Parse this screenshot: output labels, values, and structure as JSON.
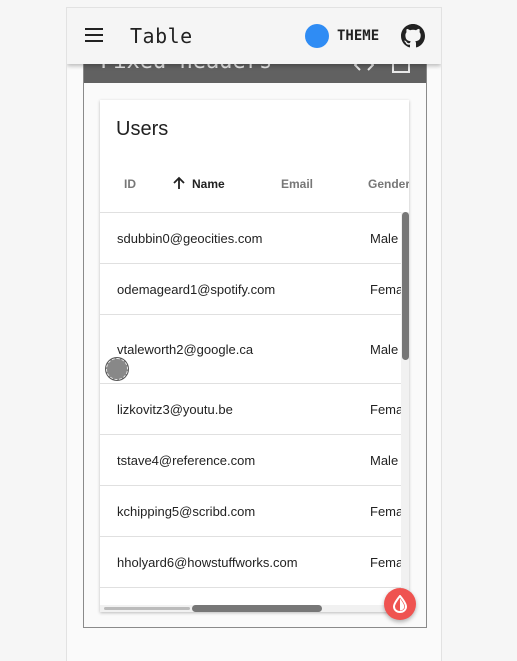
{
  "topbar": {
    "title": "Table",
    "theme_label": "THEME"
  },
  "section": {
    "title": "Fixed headers"
  },
  "card": {
    "title": "Users",
    "columns": [
      "ID",
      "Name",
      "Email",
      "Gender"
    ],
    "sorted_column": "Name",
    "rows": [
      {
        "email": "sdubbin0@geocities.com",
        "gender": "Male"
      },
      {
        "email": "odemageard1@spotify.com",
        "gender": "Fema"
      },
      {
        "email": "vtaleworth2@google.ca",
        "gender": "Male"
      },
      {
        "email": "lizkovitz3@youtu.be",
        "gender": "Fema"
      },
      {
        "email": "tstave4@reference.com",
        "gender": "Male"
      },
      {
        "email": "kchipping5@scribd.com",
        "gender": "Fema"
      },
      {
        "email": "hholyard6@howstuffworks.com",
        "gender": "Fema"
      }
    ]
  },
  "colors": {
    "accent": "#2f8cf4",
    "fab": "#ef5350",
    "header_band": "#616161"
  }
}
